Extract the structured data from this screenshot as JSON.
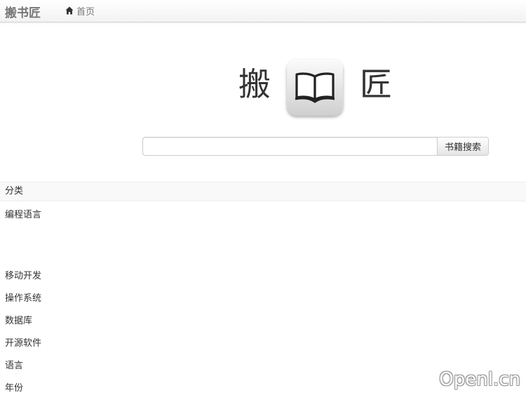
{
  "navbar": {
    "brand": "搬书匠",
    "home_label": "首页",
    "home_icon": "home-icon"
  },
  "logo": {
    "left_char": "搬",
    "right_char": "匠",
    "icon": "open-book-icon"
  },
  "search": {
    "value": "",
    "placeholder": "",
    "button_label": "书籍搜索"
  },
  "categories": {
    "header": "分类",
    "items": [
      "编程语言",
      "移动开发",
      "操作系统",
      "数据库",
      "开源软件",
      "语言",
      "年份"
    ]
  },
  "watermark": "Openl.cn"
}
